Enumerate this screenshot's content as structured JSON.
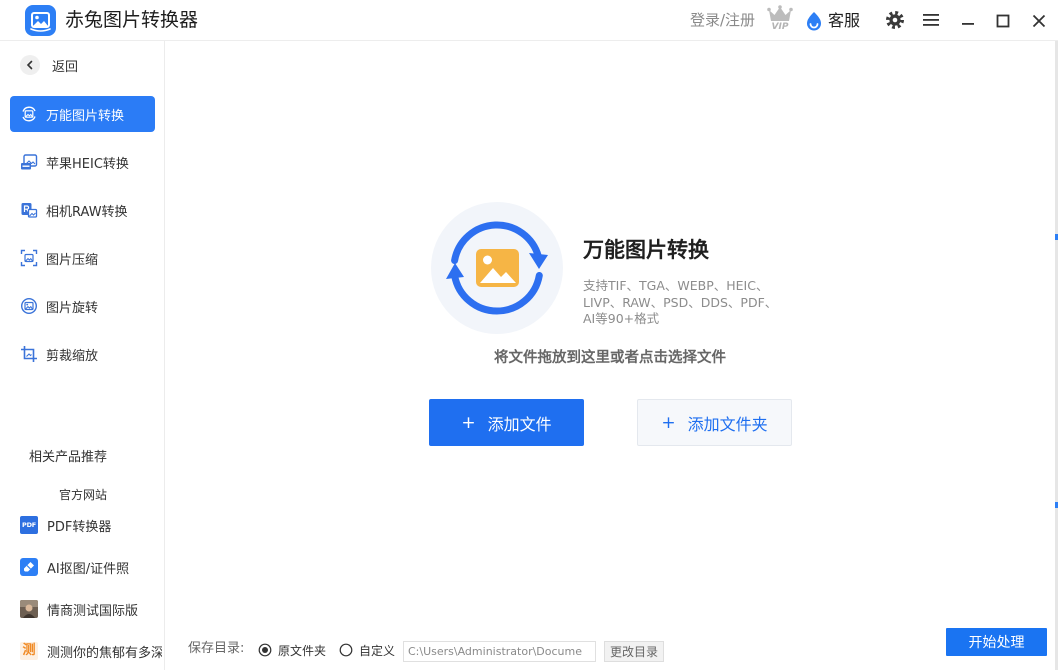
{
  "window": {
    "title": "赤兔图片转换器",
    "login_label": "登录/注册",
    "vip_label": "VIP",
    "service_label": "客服",
    "icons": [
      "app-logo-icon",
      "vip-crown-icon",
      "service-drop-icon",
      "gear-icon",
      "menu-icon",
      "minimize-icon",
      "maximize-icon",
      "close-icon"
    ]
  },
  "sidebar": {
    "back_label": "返回",
    "items": [
      {
        "label": "万能图片转换",
        "icon": "image-convert-icon",
        "active": true
      },
      {
        "label": "苹果HEIC转换",
        "icon": "heic-icon",
        "active": false
      },
      {
        "label": "相机RAW转换",
        "icon": "raw-icon",
        "active": false
      },
      {
        "label": "图片压缩",
        "icon": "compress-icon",
        "active": false
      },
      {
        "label": "图片旋转",
        "icon": "rotate-icon",
        "active": false
      },
      {
        "label": "剪裁缩放",
        "icon": "crop-icon",
        "active": false
      }
    ],
    "related_title": "相关产品推荐",
    "official_site_label": "官方网站",
    "products": [
      {
        "label": "PDF转换器",
        "icon": "pdf-icon",
        "icon_text": "PDF"
      },
      {
        "label": "AI抠图/证件照",
        "icon": "eraser-icon"
      },
      {
        "label": "情商测试国际版",
        "icon": "avatar-icon"
      },
      {
        "label": "测测你的焦郁有多深",
        "icon": "test-icon",
        "icon_text": "测"
      }
    ]
  },
  "main": {
    "feature_title": "万能图片转换",
    "feature_desc": [
      "支持TIF、TGA、WEBP、HEIC、",
      "LIVP、RAW、PSD、DDS、PDF、",
      "AI等90+格式"
    ],
    "drop_hint": "将文件拖放到这里或者点击选择文件",
    "add_file": {
      "plus": "+",
      "label": "添加文件"
    },
    "add_folder": {
      "plus": "+",
      "label": "添加文件夹"
    }
  },
  "footer": {
    "save_dir_label": "保存目录:",
    "output_options": [
      {
        "label": "原文件夹",
        "selected": true
      },
      {
        "label": "自定义",
        "selected": false
      }
    ],
    "save_path": "C:\\Users\\Administrator\\Docume",
    "change_dir_label": "更改目录",
    "start_label": "开始处理"
  },
  "colors": {
    "accent": "#2b7cf6",
    "primary_button": "#1f6ff0",
    "start_button": "#1a74f2",
    "hero_ring": "#2d6ff0",
    "hero_image": "#f6b545",
    "text_muted": "#8c8c8c",
    "icon_blue": "#3a73d9"
  }
}
